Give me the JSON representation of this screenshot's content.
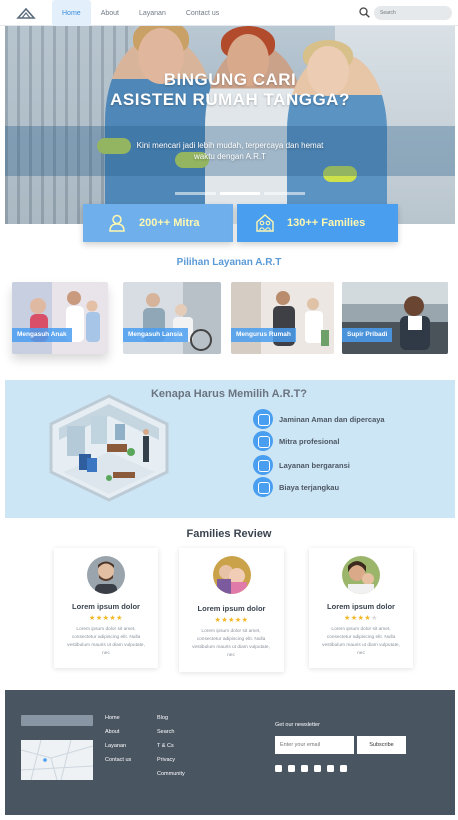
{
  "nav": {
    "items": [
      {
        "label": "Home",
        "active": true
      },
      {
        "label": "About",
        "active": false
      },
      {
        "label": "Layanan",
        "active": false
      },
      {
        "label": "Contact us",
        "active": false
      }
    ],
    "search_placeholder": "Search"
  },
  "hero": {
    "title_line1": "BINGUNG CARI",
    "title_line2": "ASISTEN RUMAH TANGGA?",
    "subtitle_line1": "Kini mencari jadi lebih mudah, terpercaya dan hemat",
    "subtitle_line2": "waktu dengan A.R.T"
  },
  "stats": [
    {
      "label": "200++ Mitra",
      "icon": "person-icon"
    },
    {
      "label": "130++ Families",
      "icon": "family-home-icon"
    }
  ],
  "services": {
    "title": "Pilihan Layanan A.R.T",
    "items": [
      "Mengasuh Anak",
      "Mengasuh Lansia",
      "Mengurus Rumah",
      "Supir Pribadi"
    ]
  },
  "why": {
    "title": "Kenapa Harus Memilih A.R.T?",
    "items": [
      "Jaminan Aman dan dipercaya",
      "Mitra profesional",
      "Layanan bergaransi",
      "Biaya terjangkau"
    ]
  },
  "reviews": {
    "title": "Families Review",
    "items": [
      {
        "name": "Lorem ipsum dolor",
        "stars": 5,
        "text": "Lorem ipsum dolor sit amet, consectetur adipiscing elit. Nulla vestibulum mauris ut diam vulputate, nec"
      },
      {
        "name": "Lorem ipsum dolor",
        "stars": 5,
        "text": "Lorem ipsum dolor sit amet, consectetur adipiscing elit. Nulla vestibulum mauris ut diam vulputate, nec"
      },
      {
        "name": "Lorem ipsum dolor",
        "stars": 4,
        "text": "Lorem ipsum dolor sit amet, consectetur adipiscing elit. Nulla vestibulum mauris ut diam vulputate, nec"
      }
    ]
  },
  "footer": {
    "col1": [
      "Home",
      "About",
      "Layanan",
      "Contact us"
    ],
    "col2": [
      "Blog",
      "Search",
      "T & Cs",
      "Privacy",
      "Community"
    ],
    "newsletter_label": "Get our newsletter",
    "email_placeholder": "Enter your email",
    "subscribe_label": "Subscribe",
    "social_icons": [
      "facebook-icon",
      "instagram-icon",
      "snapchat-icon",
      "twitter-icon",
      "youtube-icon",
      "whatsapp-icon"
    ]
  },
  "colors": {
    "accent": "#4a9ef0",
    "section_bg": "#cde6f5",
    "footer_bg": "#4a5562",
    "star": "#f2b623"
  }
}
